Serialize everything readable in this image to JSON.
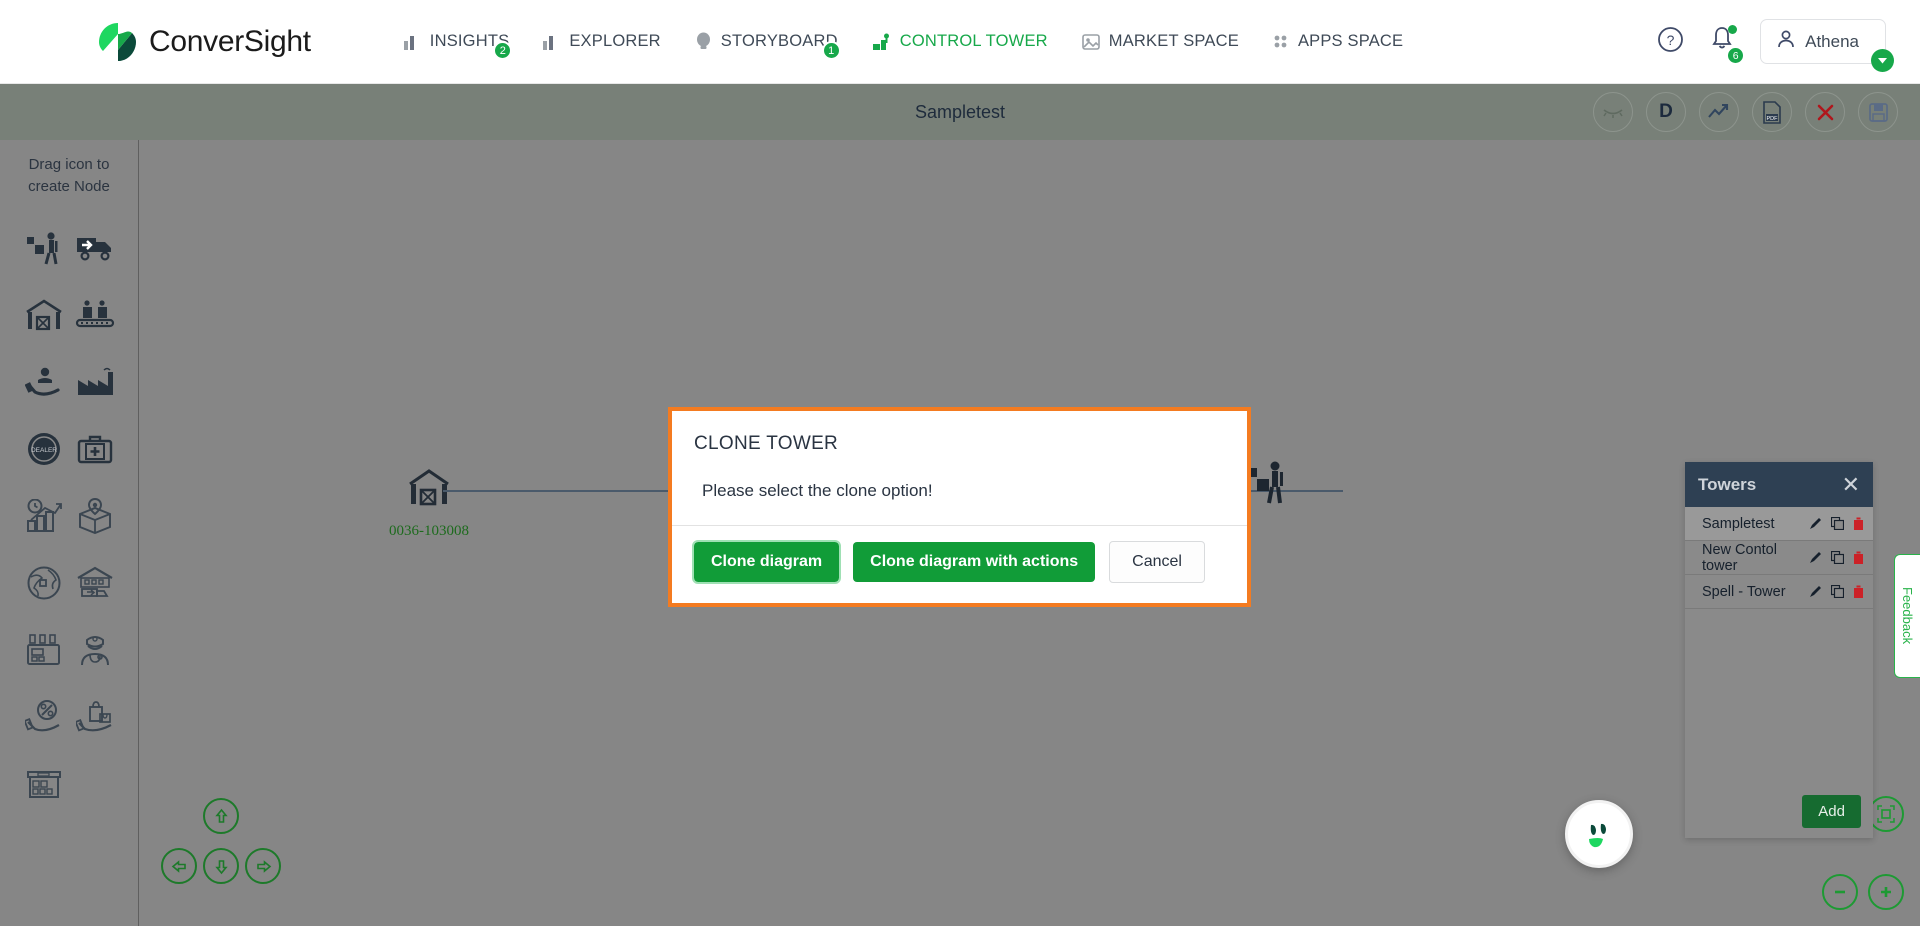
{
  "topnav": {
    "brand": "ConverSight",
    "items": [
      {
        "label": "INSIGHTS",
        "icon": "bar-chart-icon",
        "badge": "2",
        "active": false
      },
      {
        "label": "EXPLORER",
        "icon": "bar-chart-icon",
        "badge": "",
        "active": false
      },
      {
        "label": "STORYBOARD",
        "icon": "lightbulb-icon",
        "badge": "1",
        "active": false
      },
      {
        "label": "CONTROL TOWER",
        "icon": "control-tower-icon",
        "badge": "",
        "active": true
      },
      {
        "label": "MARKET SPACE",
        "icon": "market-icon",
        "badge": "",
        "active": false
      },
      {
        "label": "APPS SPACE",
        "icon": "apps-grid-icon",
        "badge": "",
        "active": false
      }
    ],
    "help_icon": "help-circle-icon",
    "notification_icon": "bell-icon",
    "notification_count": "6",
    "user_name": "Athena",
    "user_icon": "user-avatar-icon"
  },
  "subheader": {
    "title": "Sampletest",
    "tools": [
      {
        "name": "eye-closed-icon",
        "label": ""
      },
      {
        "name": "dictionary-d-icon",
        "label": "D"
      },
      {
        "name": "trend-up-icon",
        "label": ""
      },
      {
        "name": "pdf-export-icon",
        "label": ""
      },
      {
        "name": "close-red-icon",
        "label": ""
      },
      {
        "name": "save-disk-icon",
        "label": ""
      }
    ]
  },
  "sidebar": {
    "hint_line1": "Drag icon to",
    "hint_line2": "create Node",
    "icons": [
      "worker-inventory-icon",
      "delivery-truck-icon",
      "warehouse-icon",
      "assembly-line-icon",
      "hand-customer-icon",
      "factory-icon",
      "dealer-badge-icon",
      "first-aid-kit-icon",
      "analytics-growth-icon",
      "package-location-icon",
      "globe-logistics-icon",
      "distribution-center-icon",
      "lab-equipment-icon",
      "healthcare-worker-icon",
      "discount-percent-icon",
      "retail-bag-icon",
      "store-shelf-icon"
    ]
  },
  "canvas": {
    "nodes": [
      {
        "label": "0036-103008",
        "icon": "warehouse-icon"
      },
      {
        "label": "",
        "icon": "worker-inventory-icon"
      }
    ],
    "dpad": [
      {
        "name": "pan-up-button",
        "glyph": "↑"
      },
      {
        "name": "pan-left-button",
        "glyph": "←"
      },
      {
        "name": "pan-down-button",
        "glyph": "↓"
      },
      {
        "name": "pan-right-button",
        "glyph": "→"
      }
    ],
    "zoom_controls": [
      {
        "name": "fit-screen-button"
      },
      {
        "name": "zoom-out-button"
      },
      {
        "name": "zoom-in-button"
      }
    ]
  },
  "towers_panel": {
    "title": "Towers",
    "close_icon": "close-icon",
    "rows": [
      {
        "name": "Sampletest",
        "selected": true
      },
      {
        "name": "New Contol tower",
        "selected": false
      },
      {
        "name": "Spell - Tower",
        "selected": false
      }
    ],
    "row_action_icons": [
      "edit-pencil-icon",
      "copy-icon",
      "delete-trash-icon"
    ],
    "add_label": "Add"
  },
  "feedback": {
    "label": "Feedback"
  },
  "assistant": {
    "name": "athena-assistant-avatar"
  },
  "modal": {
    "title": "CLONE TOWER",
    "message": "Please select the clone option!",
    "primary_label": "Clone diagram",
    "secondary_label": "Clone diagram with actions",
    "cancel_label": "Cancel"
  },
  "colors": {
    "brand_green": "#17a84a",
    "modal_border_orange": "#f47b20",
    "button_green": "#119c38",
    "panel_header_navy": "#2e4053",
    "canvas_gray": "#868686",
    "subheader_gray": "#788078",
    "node_label_green": "#1d6b1d",
    "delete_red": "#cc2127"
  }
}
